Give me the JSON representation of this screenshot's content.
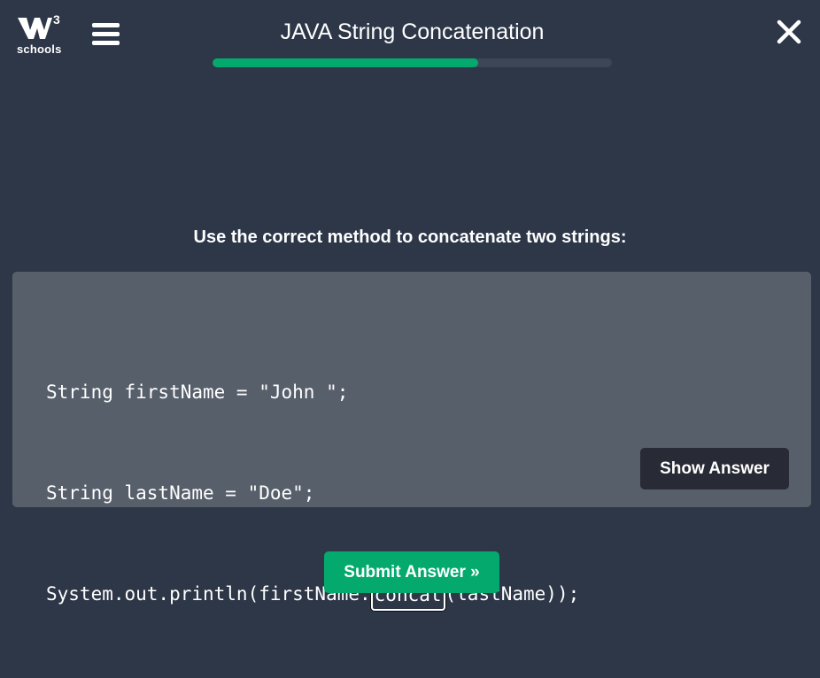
{
  "header": {
    "logo_text": "w",
    "logo_superscript": "3",
    "logo_wordmark": "schools",
    "title": "JAVA String Concatenation",
    "progress_fraction": 0.665,
    "progress_color": "#04aa6d",
    "menu_icon": "hamburger-menu-icon",
    "close_icon": "close-x-icon"
  },
  "exercise": {
    "instruction_prefix": "Use the correct method to ",
    "instruction_emphasis": "concatenate",
    "instruction_suffix": " two strings:",
    "code_line_1": "String firstName = \"John \";",
    "code_line_2": "String lastName = \"Doe\";",
    "code_line_3_prefix": "System.out.println(firstName.",
    "answer_value": "concat",
    "code_line_3_suffix": "(lastName));",
    "show_answer_label": "Show Answer"
  },
  "footer": {
    "submit_label": "Submit Answer »"
  },
  "colors": {
    "background": "#2d3748",
    "code_box": "#575f6b",
    "accent_green": "#04aa6d",
    "dark_button": "#282a35"
  }
}
